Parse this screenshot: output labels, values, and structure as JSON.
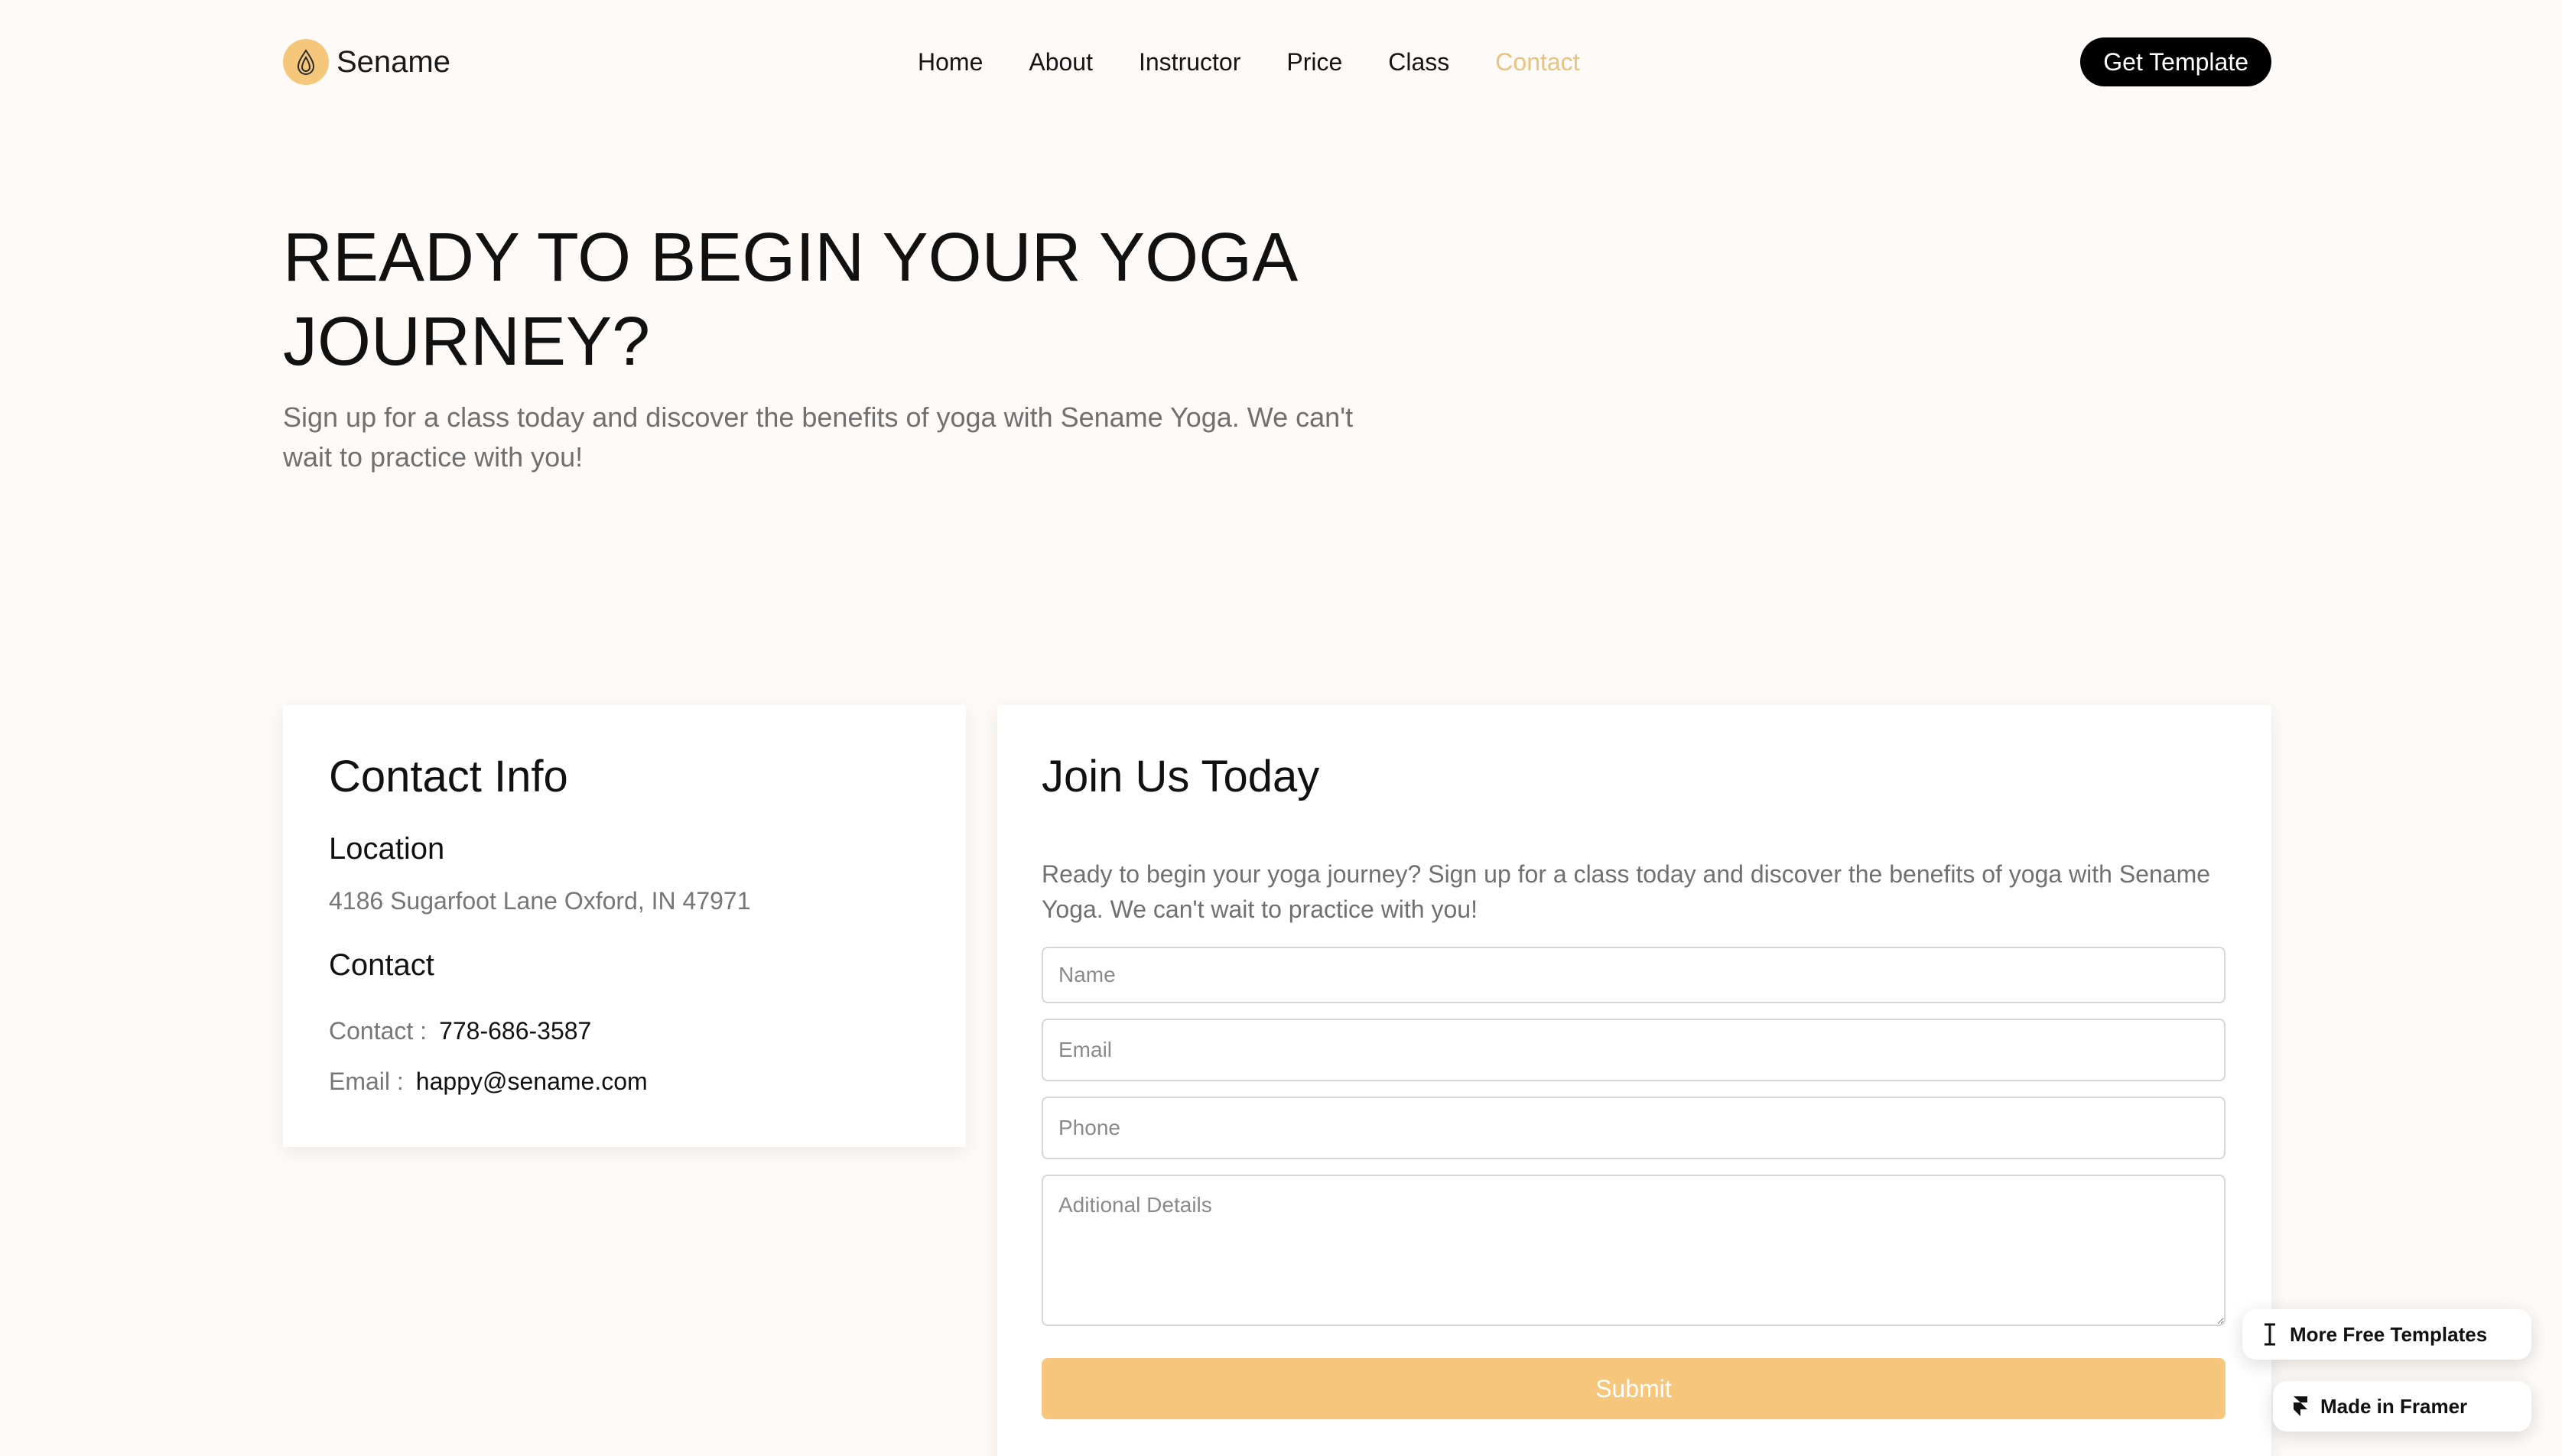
{
  "brand": {
    "name": "Sename",
    "logo_icon": "lotus-drop-icon",
    "accent": "#f5c77b"
  },
  "nav": {
    "links": [
      {
        "label": "Home",
        "active": false
      },
      {
        "label": "About",
        "active": false
      },
      {
        "label": "Instructor",
        "active": false
      },
      {
        "label": "Price",
        "active": false
      },
      {
        "label": "Class",
        "active": false
      },
      {
        "label": "Contact",
        "active": true
      }
    ],
    "cta_label": "Get Template",
    "active_color": "#e9c37f"
  },
  "hero": {
    "title": "READY TO BEGIN YOUR YOGA JOURNEY?",
    "subtitle": "Sign up for a class today and discover the benefits of yoga with Sename Yoga. We can't wait to practice with you!"
  },
  "contact_card": {
    "title": "Contact Info",
    "location_heading": "Location",
    "location_text": "4186 Sugarfoot Lane Oxford, IN 47971",
    "contact_heading": "Contact",
    "contact_label": "Contact :",
    "contact_value": "778-686-3587",
    "email_label": "Email :",
    "email_value": "happy@sename.com"
  },
  "join_card": {
    "title": "Join Us Today",
    "description": "Ready to begin your yoga journey? Sign up for a class today and discover the benefits of yoga with Sename Yoga. We can't wait to practice with you!",
    "name_placeholder": "Name",
    "email_placeholder": "Email",
    "phone_placeholder": "Phone",
    "details_placeholder": "Aditional Details",
    "submit_label": "Submit",
    "submit_color": "#f5c67b"
  },
  "badges": {
    "more_templates": "More Free Templates",
    "more_icon": "text-cursor-icon",
    "made_in_framer": "Made in Framer",
    "framer_icon": "framer-logo-icon"
  }
}
